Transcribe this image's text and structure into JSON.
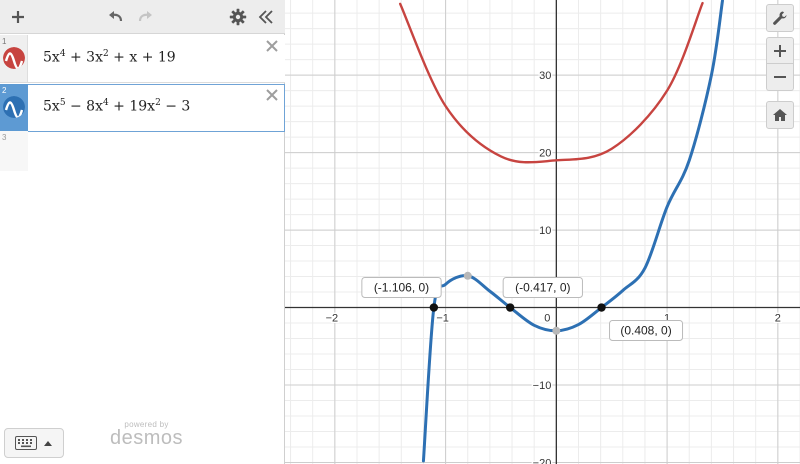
{
  "toolbar": {
    "add_icon": "plus-icon",
    "undo_icon": "undo-icon",
    "redo_icon": "redo-icon",
    "settings_icon": "gear-icon",
    "collapse_icon": "double-chevron-left-icon"
  },
  "expressions": [
    {
      "index": "1",
      "color": "#c74440",
      "latex_parts": [
        "5x",
        "4",
        " + 3x",
        "2",
        " + x + 19"
      ]
    },
    {
      "index": "2",
      "color": "#2d70b3",
      "latex_parts": [
        "5x",
        "5",
        " − 8x",
        "4",
        " + 19x",
        "2",
        " − 3"
      ]
    }
  ],
  "empty_index": "3",
  "branding": {
    "powered": "powered by",
    "name": "desmos"
  },
  "right_tools": [
    "wrench-icon",
    "zoom-in-icon",
    "zoom-out-icon",
    "home-icon"
  ],
  "points": [
    {
      "label": "(-1.106, 0)",
      "x": -1.106,
      "y": 0
    },
    {
      "label": "(-0.417, 0)",
      "x": -0.417,
      "y": 0
    },
    {
      "label": "(0.408, 0)",
      "x": 0.408,
      "y": 0
    }
  ],
  "gray_points": [
    {
      "x": -0.8,
      "y": 4.1
    },
    {
      "x": 0,
      "y": -3
    }
  ],
  "chart_data": {
    "type": "line",
    "xlim": [
      -2.45,
      2.2
    ],
    "ylim": [
      -20.2,
      39.7
    ],
    "x_ticks": [
      -2,
      -1,
      0,
      1,
      2
    ],
    "y_ticks": [
      -20,
      -10,
      10,
      20,
      30
    ],
    "origin_label": "0",
    "grid": true,
    "series": [
      {
        "color": "#c74440",
        "x": [
          -1.41,
          -1.0,
          -0.5,
          0,
          0.5,
          1.0,
          1.32
        ],
        "y": [
          39.2,
          26.0,
          19.5,
          19.0,
          20.5,
          28.0,
          39.3
        ]
      },
      {
        "color": "#2d70b3",
        "x": [
          -1.2,
          -1.106,
          -1.0,
          -0.8,
          -0.6,
          -0.417,
          -0.2,
          0,
          0.2,
          0.408,
          0.6,
          0.8,
          1.0,
          1.2,
          1.4,
          1.5
        ],
        "y": [
          -19.8,
          0,
          3.0,
          4.1,
          2.1,
          0,
          -2.3,
          -3.0,
          -2.2,
          0,
          2.2,
          5.1,
          13.0,
          19.0,
          30.0,
          39.6
        ]
      }
    ]
  }
}
